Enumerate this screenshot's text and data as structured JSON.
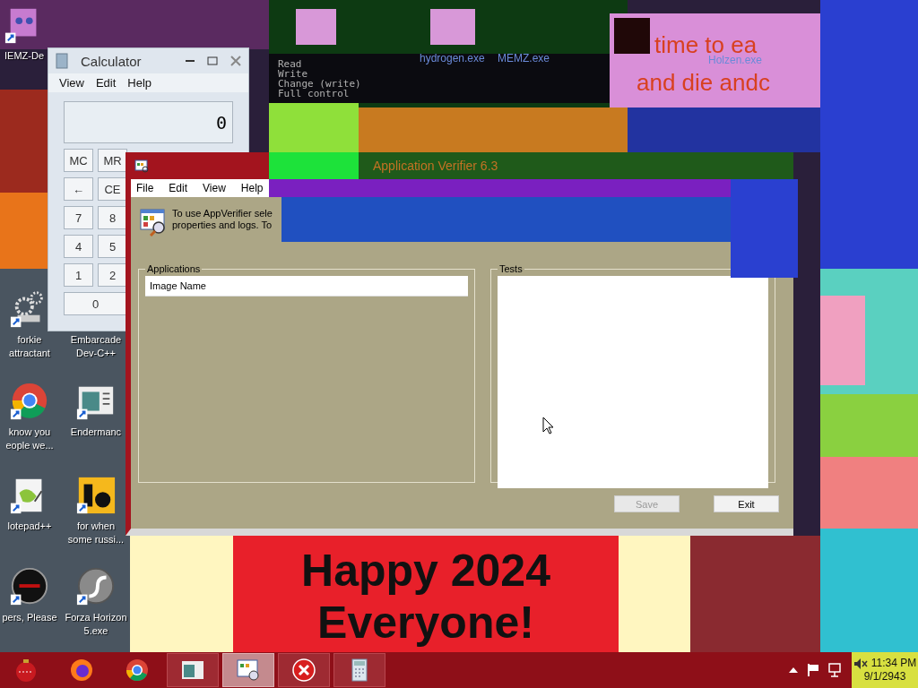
{
  "desktop_icons": [
    {
      "label": "IEMZ-De",
      "kind": "face"
    },
    {
      "label": "forkie\nattractant",
      "kind": "gear"
    },
    {
      "label": "Embarcade\nDev-C++",
      "kind": "covered"
    },
    {
      "label": "know you\neople we...",
      "kind": "chrome"
    },
    {
      "label": "Endermanc",
      "kind": "window"
    },
    {
      "label": "lotepad++",
      "kind": "notepad"
    },
    {
      "label": "for when\nsome russi...",
      "kind": "tile"
    },
    {
      "label": "pers, Please",
      "kind": "disc"
    },
    {
      "label": "Forza Horizon\n5.exe",
      "kind": "orb"
    }
  ],
  "top_icon_labels": [
    "hydrogen.exe",
    "MEMZ.exe",
    "Holzen.exe"
  ],
  "console_lines": [
    "Read",
    "Write",
    "Change (write)",
    "Full control"
  ],
  "wallpaper_texts": [
    "time to ea",
    "and die andc"
  ],
  "greeting": "Happy 2024\nEveryone!",
  "calculator": {
    "title": "Calculator",
    "menu": [
      "View",
      "Edit",
      "Help"
    ],
    "display": "0",
    "keys": [
      [
        "MC",
        "MR"
      ],
      [
        "←",
        "CE"
      ],
      [
        "7",
        "8"
      ],
      [
        "4",
        "5"
      ],
      [
        "1",
        "2"
      ],
      [
        "0"
      ]
    ]
  },
  "app_verifier": {
    "title": "Application Verifier 6.3",
    "menu": [
      "File",
      "Edit",
      "View",
      "Help"
    ],
    "instructions": [
      "To use AppVerifier sele",
      "properties and logs. To"
    ],
    "applications": {
      "legend": "Applications",
      "column": "Image Name"
    },
    "tests": {
      "legend": "Tests"
    },
    "buttons": [
      {
        "label": "Save",
        "disabled": true
      },
      {
        "label": "Exit",
        "disabled": false
      }
    ]
  },
  "taskbar": {
    "items": [
      {
        "kind": "ornament",
        "open": false,
        "selected": false
      },
      {
        "kind": "firefox",
        "open": false,
        "selected": false
      },
      {
        "kind": "chrome",
        "open": false,
        "selected": false
      },
      {
        "kind": "window",
        "open": true,
        "selected": false
      },
      {
        "kind": "verifier",
        "open": true,
        "selected": true
      },
      {
        "kind": "error",
        "open": true,
        "selected": false
      },
      {
        "kind": "calculator",
        "open": true,
        "selected": false
      }
    ],
    "time": "11:34 PM",
    "date": "9/1/2943"
  }
}
